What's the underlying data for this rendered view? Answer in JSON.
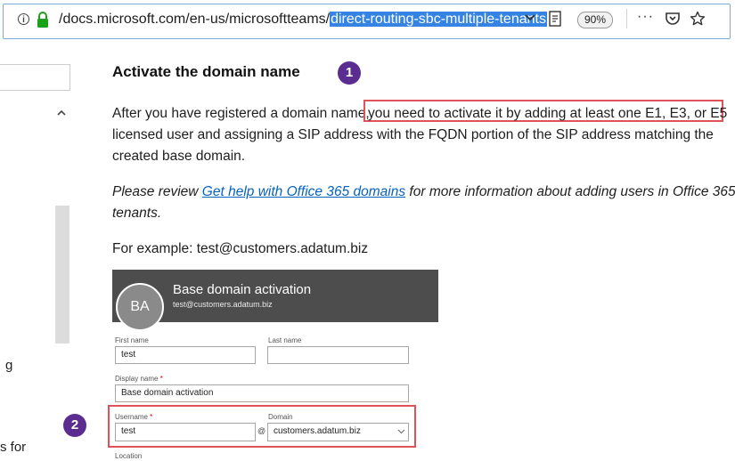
{
  "browser": {
    "url_base": "/docs.microsoft.com/en-us/microsoftteams/",
    "url_selected": "direct-routing-sbc-multiple-tenants",
    "zoom": "90%",
    "more": "···"
  },
  "sidebar": {
    "fragment_g": "g",
    "fragment_s_for": "s for"
  },
  "article": {
    "heading": "Activate the domain name",
    "badge1": "1",
    "badge2": "2",
    "p1_line1_a": "After you have registered a domain name,",
    "p1_line1_b": "you need to activate it by adding at least one E1, E3, or E5",
    "p1_line2": "licensed user and assigning a SIP address with the FQDN portion of the SIP address matching the",
    "p1_line3": "created base domain.",
    "p2_prefix": "Please review ",
    "p2_link": "Get help with Office 365 domains",
    "p2_suffix": " for more information about adding users in Office 365",
    "p2_line2": "tenants.",
    "p3": "For example: test@customers.adatum.biz"
  },
  "screenshot": {
    "avatar": "BA",
    "title": "Base domain activation",
    "subtitle": "test@customers.adatum.biz",
    "first_name_label": "First name",
    "first_name_value": "test",
    "last_name_label": "Last name",
    "last_name_value": "",
    "display_name_label": "Display name",
    "display_name_value": "Base domain activation",
    "username_label": "Username",
    "username_value": "test",
    "at": "@",
    "domain_label": "Domain",
    "domain_value": "customers.adatum.biz",
    "location_label": "Location",
    "required_mark": "*"
  },
  "colors": {
    "badge": "#5c2d91",
    "highlight_box": "#e0525a",
    "link": "#0563c1",
    "url_selection": "#3584e4"
  }
}
